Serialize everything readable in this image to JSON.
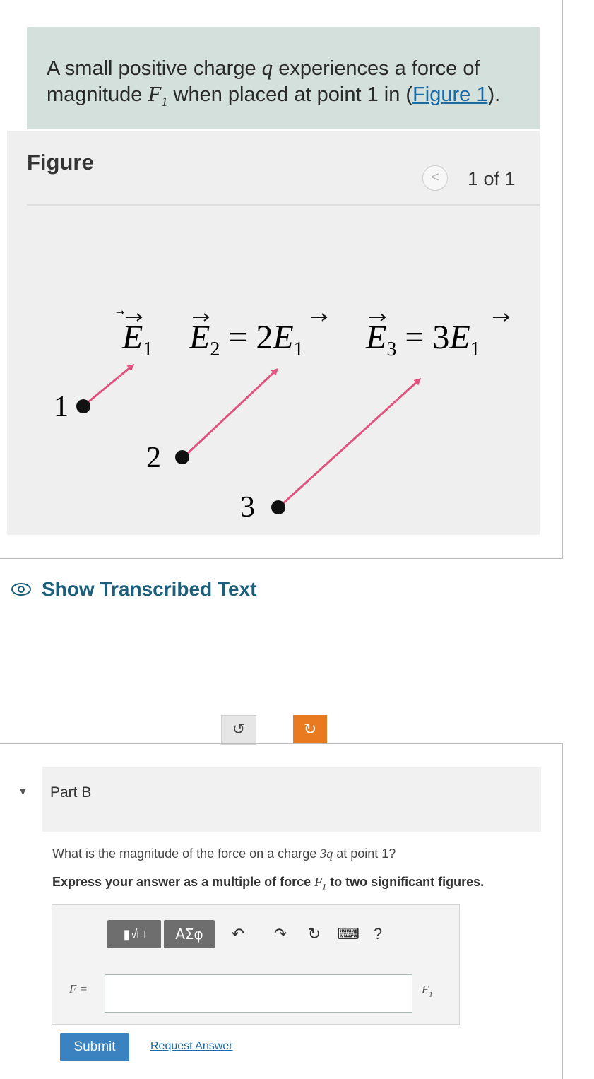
{
  "problem": {
    "text_before_q": "A small positive charge ",
    "var_q": "q",
    "text_after_q": " experiences a force of magnitude ",
    "var_F1": "F",
    "var_F1_sub": "1",
    "text_after_F1": " when placed at point 1 in (",
    "figure_link": "Figure 1",
    "text_end": ")."
  },
  "figure": {
    "title": "Figure",
    "pager_prev": "<",
    "pager_count": "1 of 1",
    "labels": {
      "e1": "E",
      "e1_sub": "1",
      "e2": "E",
      "e2_sub": "2",
      "e2_eq": " = 2",
      "e2_rhs": "E",
      "e2_rhs_sub": "1",
      "e3": "E",
      "e3_sub": "3",
      "e3_eq": " = 3",
      "e3_rhs": "E",
      "e3_rhs_sub": "1"
    },
    "points": [
      "1",
      "2",
      "3"
    ],
    "arrow_multiples": [
      1,
      2,
      3
    ],
    "arrow_color": "#e0537f"
  },
  "transcribed": {
    "label": "Show Transcribed Text",
    "icon": "eye-icon"
  },
  "nav": {
    "undo_icon": "↺",
    "redo_icon": "↻",
    "redo_color": "#ea7a1f"
  },
  "part_b": {
    "label": "Part B",
    "expand_icon": "▼",
    "question_before": "What is the magnitude of the force on a charge ",
    "question_var": "3q",
    "question_after": " at point 1?",
    "instruction_before": "Express your answer as a multiple of force ",
    "instruction_var": "F",
    "instruction_var_sub": "1",
    "instruction_after": " to two significant figures.",
    "toolbar": {
      "template_label": "▮√□",
      "greek_label": "ΑΣφ",
      "undo": "↶",
      "redo": "↷",
      "reset": "↻",
      "keyboard": "⌨",
      "help": "?"
    },
    "answer_label": "F =",
    "answer_value": "",
    "unit": "F",
    "unit_sub": "1",
    "submit_label": "Submit",
    "request_label": "Request Answer"
  }
}
